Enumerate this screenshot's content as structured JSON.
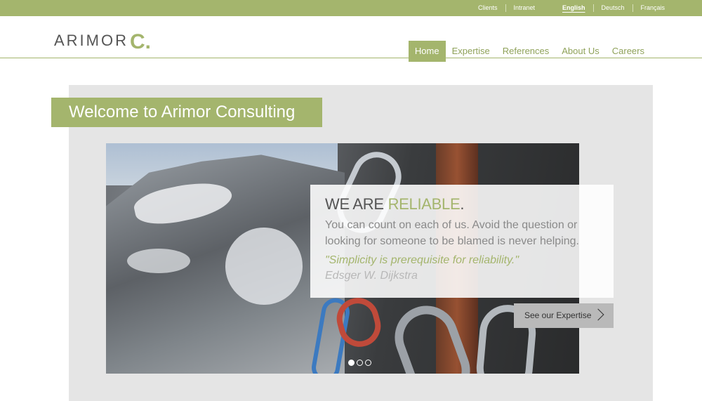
{
  "topbar": {
    "links_left": [
      "Clients",
      "Intranet"
    ],
    "languages": [
      "English",
      "Deutsch",
      "Français"
    ],
    "active_language": "English"
  },
  "logo": {
    "text": "ARIMOR",
    "mark": "C."
  },
  "nav": {
    "items": [
      "Home",
      "Expertise",
      "References",
      "About Us",
      "Careers"
    ],
    "active": "Home"
  },
  "welcome": {
    "title": "Welcome to Arimor Consulting"
  },
  "slide": {
    "headline_prefix": "WE ARE ",
    "headline_highlight": "RELIABLE",
    "headline_suffix": ".",
    "body": "You can count on each of us. Avoid the question or looking for someone to be blamed is never helping.",
    "quote": "\"Simplicity is prerequisite for reliability.\"",
    "author": "Edsger W. Dijkstra",
    "cta_label": "See our Expertise",
    "pager": {
      "count": 3,
      "active": 1
    }
  },
  "colors": {
    "accent": "#a4b56d",
    "stage_bg": "#e5e5e5",
    "cta_bg": "#b9b9b9"
  }
}
